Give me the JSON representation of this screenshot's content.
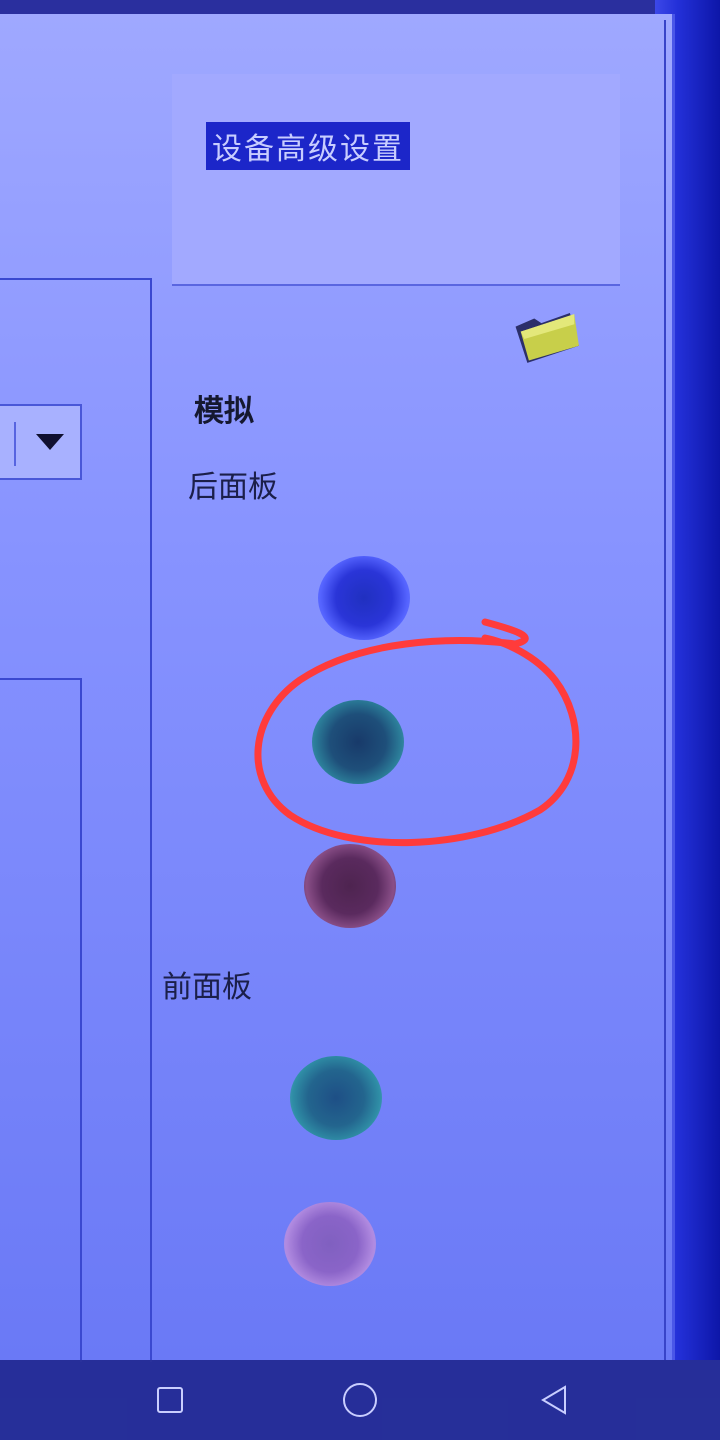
{
  "panel": {
    "title": "设备高级设置",
    "mode_label": "模拟",
    "rear_panel_label": "后面板",
    "front_panel_label": "前面板"
  },
  "ports": {
    "rear": [
      "blue",
      "green",
      "pink"
    ],
    "front": [
      "green",
      "pink"
    ],
    "highlighted": "rear-green"
  },
  "icons": {
    "folder": "folder-icon",
    "dropdown": "dropdown-arrow-icon",
    "nav_recent": "square-icon",
    "nav_home": "circle-icon",
    "nav_back": "triangle-back-icon"
  },
  "colors": {
    "screen_bg": "#8793ff",
    "header_bg": "#a2a9ff",
    "title_highlight": "#1c26c9",
    "annotation": "#ff3b3b"
  }
}
